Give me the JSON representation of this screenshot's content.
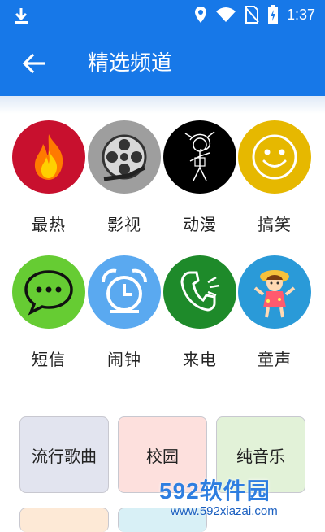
{
  "status_bar": {
    "time": "1:37",
    "icons": [
      "download-icon",
      "location-icon",
      "wifi-icon",
      "no-sim-icon",
      "battery-charging-icon"
    ]
  },
  "app_bar": {
    "title": "精选频道",
    "back_icon": "arrow-left-icon"
  },
  "channels": [
    {
      "label": "最热",
      "icon": "fire-icon",
      "color": "#c8102e"
    },
    {
      "label": "影视",
      "icon": "film-reel-icon",
      "color": "#9e9e9e"
    },
    {
      "label": "动漫",
      "icon": "anime-sketch-icon",
      "color": "#000000"
    },
    {
      "label": "搞笑",
      "icon": "smiley-icon",
      "color": "#e6b800"
    },
    {
      "label": "短信",
      "icon": "chat-bubble-icon",
      "color": "#66cc33"
    },
    {
      "label": "闹钟",
      "icon": "alarm-clock-icon",
      "color": "#5aa9f0"
    },
    {
      "label": "来电",
      "icon": "phone-ringing-icon",
      "color": "#1e8a2a"
    },
    {
      "label": "童声",
      "icon": "child-icon",
      "color": "#2a9ad8"
    }
  ],
  "categories": [
    {
      "label": "流行歌曲",
      "color": "#e2e4ef"
    },
    {
      "label": "校园",
      "color": "#fde0dd"
    },
    {
      "label": "纯音乐",
      "color": "#e2f2d8"
    }
  ],
  "watermark": {
    "main": "592软件园",
    "sub": "www.592xiazai.com"
  }
}
